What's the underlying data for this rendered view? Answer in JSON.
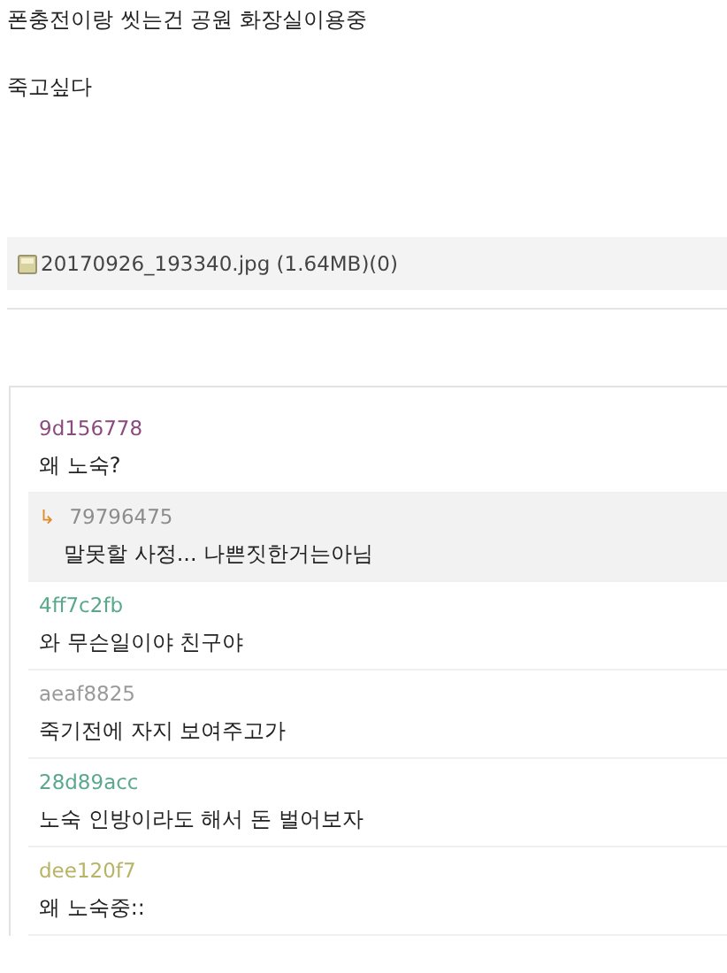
{
  "post": {
    "lines": [
      "폰충전이랑 씻는건 공원 화장실이용중",
      "죽고싶다"
    ]
  },
  "attachment": {
    "filename": "20170926_193340.jpg (1.64MB)(0)"
  },
  "comments": [
    {
      "kind": "comment",
      "author": "9d156778",
      "color": "#8b4a7e",
      "text": "왜 노숙?"
    },
    {
      "kind": "reply",
      "author": "79796475",
      "color": "#8c8c8c",
      "marker": "↳",
      "text": "말못할 사정... 나쁜짓한거는아님"
    },
    {
      "kind": "comment",
      "author": "4ff7c2fb",
      "color": "#58a98c",
      "text": "와 무슨일이야 친구야"
    },
    {
      "kind": "comment",
      "author": "aeaf8825",
      "color": "#9a9a9a",
      "text": "죽기전에 자지 보여주고가"
    },
    {
      "kind": "comment",
      "author": "28d89acc",
      "color": "#5aa88e",
      "text": "노숙 인방이라도 해서 돈 벌어보자"
    },
    {
      "kind": "comment",
      "author": "dee120f7",
      "color": "#b8b466",
      "text": "왜 노숙중::"
    }
  ]
}
